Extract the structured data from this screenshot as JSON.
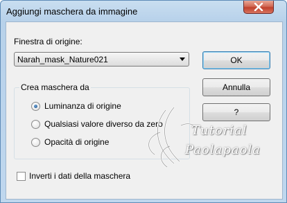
{
  "window": {
    "title": "Aggiungi maschera da immagine"
  },
  "source": {
    "label": "Finestra di origine:",
    "selected": "Narah_mask_Nature021"
  },
  "buttons": {
    "ok": "OK",
    "annulla": "Annulla",
    "help": "?"
  },
  "mask_group": {
    "title": "Crea maschera da",
    "options": [
      {
        "label": "Luminanza di origine",
        "selected": true
      },
      {
        "label": "Qualsiasi valore diverso da zero",
        "selected": false
      },
      {
        "label": "Opacità di origine",
        "selected": false
      }
    ]
  },
  "invert": {
    "label": "Inverti i dati della maschera",
    "checked": false
  },
  "watermark": {
    "line1": "Tutorial",
    "line2": "Paolapaola"
  },
  "colors": {
    "accent": "#3c7fb1",
    "close": "#c0412c",
    "window_frame": "#b7d1ea"
  }
}
